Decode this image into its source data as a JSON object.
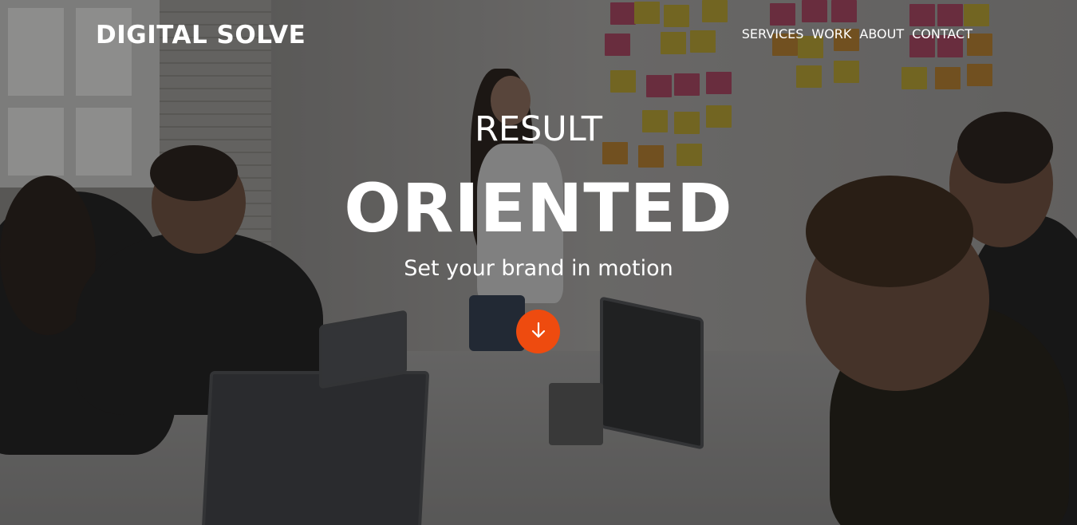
{
  "header": {
    "logo": "DIGITAL SOLVE",
    "nav": [
      {
        "label": "SERVICES"
      },
      {
        "label": "WORK"
      },
      {
        "label": "ABOUT"
      },
      {
        "label": "CONTACT"
      }
    ]
  },
  "hero": {
    "kicker": "RESULT",
    "headline": "ORIENTED",
    "tagline": "Set your brand in motion",
    "scroll_icon": "arrow-down-icon",
    "background_image": "office-meeting-photo"
  },
  "colors": {
    "accent": "#ee4b0f",
    "text": "#ffffff"
  }
}
